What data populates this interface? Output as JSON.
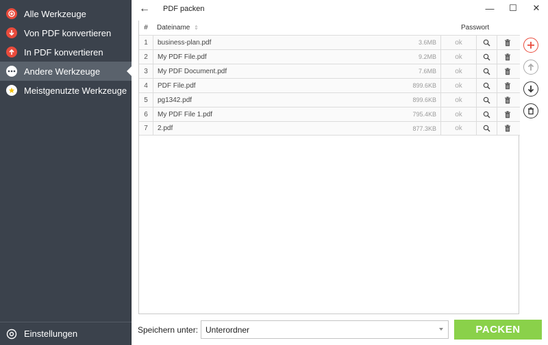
{
  "sidebar": {
    "items": [
      {
        "label": "Alle Werkzeuge",
        "icon": "target-icon"
      },
      {
        "label": "Von PDF konvertieren",
        "icon": "arrow-down-icon"
      },
      {
        "label": "In PDF konvertieren",
        "icon": "arrow-up-icon"
      },
      {
        "label": "Andere Werkzeuge",
        "icon": "more-icon",
        "active": true
      },
      {
        "label": "Meistgenutzte Werkzeuge",
        "icon": "star-icon"
      }
    ],
    "settings_label": "Einstellungen"
  },
  "titlebar": {
    "back_glyph": "←",
    "title": "PDF packen",
    "minimize": "—",
    "maximize": "☐",
    "close": "✕"
  },
  "table": {
    "headers": {
      "num": "#",
      "name": "Dateiname",
      "password": "Passwort"
    },
    "rows": [
      {
        "num": "1",
        "name": "business-plan.pdf",
        "size": "3.6MB",
        "password": "ok"
      },
      {
        "num": "2",
        "name": "My PDF File.pdf",
        "size": "9.2MB",
        "password": "ok"
      },
      {
        "num": "3",
        "name": "My PDF Document.pdf",
        "size": "7.6MB",
        "password": "ok"
      },
      {
        "num": "4",
        "name": "PDF File.pdf",
        "size": "899.6KB",
        "password": "ok"
      },
      {
        "num": "5",
        "name": "pg1342.pdf",
        "size": "899.6KB",
        "password": "ok"
      },
      {
        "num": "6",
        "name": "My PDF File 1.pdf",
        "size": "795.4KB",
        "password": "ok"
      },
      {
        "num": "7",
        "name": "2.pdf",
        "size": "877.3KB",
        "password": "ok"
      }
    ]
  },
  "bottom": {
    "save_label": "Speichern unter:",
    "folder_value": "Unterordner",
    "pack_label": "PACKEN"
  },
  "colors": {
    "accent_red": "#e94b3c",
    "pack_green": "#8ad14a",
    "sidebar_bg": "#3b424c"
  }
}
